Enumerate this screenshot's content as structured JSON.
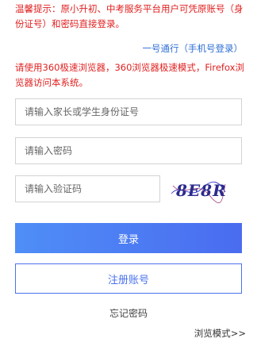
{
  "notice": {
    "text": "温馨提示：原小升初、中考服务平台用户可凭原账号（身份证号）和密码直接登录。"
  },
  "login_link": {
    "text": "一号通行（手机号登录）"
  },
  "browser_tip": {
    "text": "请使用360极速浏览器，360浏览器极速模式，Firefox浏览器访问本系统。"
  },
  "form": {
    "id_placeholder": "请输入家长或学生身份证号",
    "password_placeholder": "请输入密码",
    "code_placeholder": "请输入验证码",
    "captcha_text": "8E8R",
    "login_label": "登录",
    "register_label": "注册账号",
    "forgot_label": "忘记密码"
  },
  "footer": {
    "browse_mode_label": "浏览模式>>"
  },
  "colors": {
    "alert_red": "#e02020",
    "link_blue": "#2f6fd6",
    "primary_blue": "#4a72ef"
  }
}
